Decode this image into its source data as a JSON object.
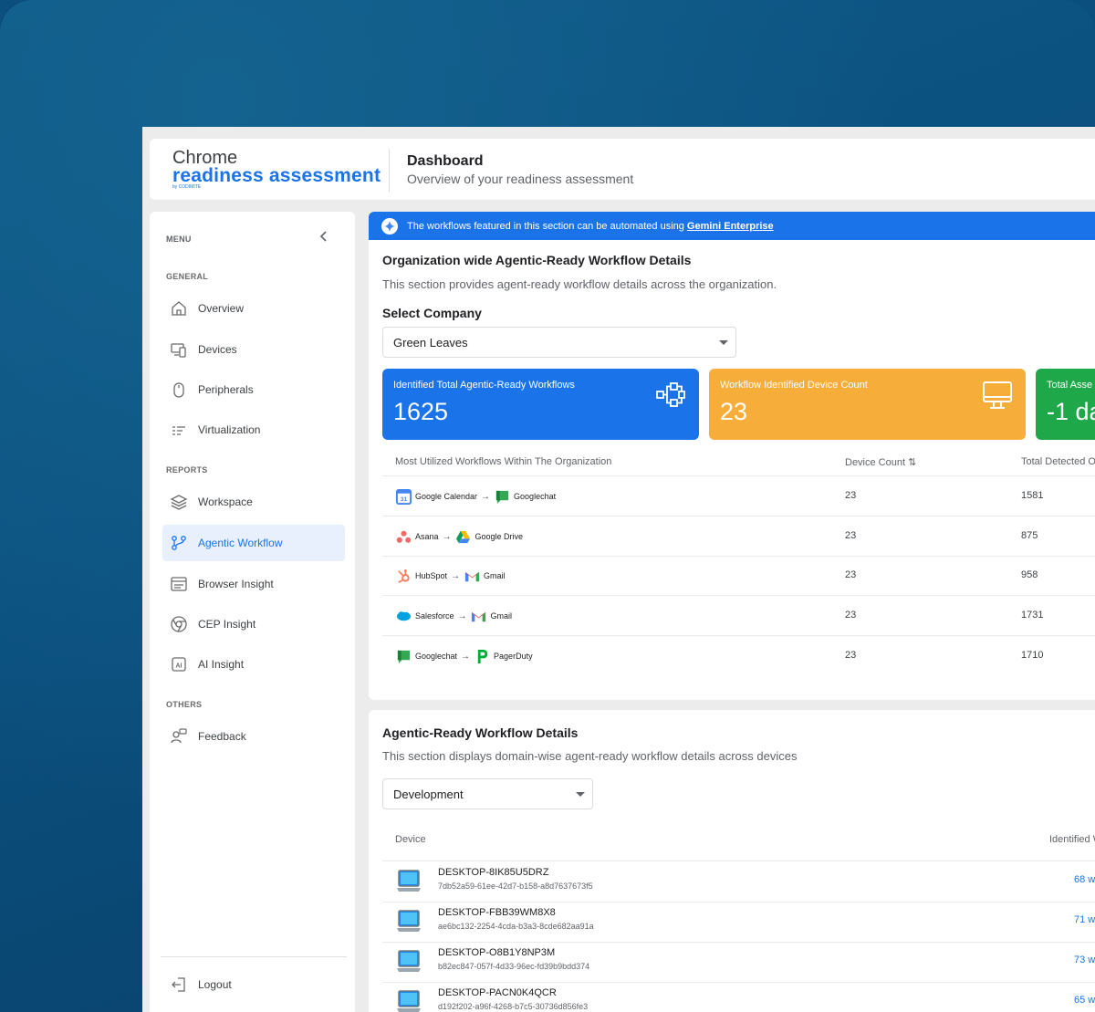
{
  "app": {
    "logo_line1": "Chrome",
    "logo_line2": "readiness assessment",
    "logo_line3": "by CODIMITE",
    "page_title": "Dashboard",
    "page_subtitle": "Overview of your readiness assessment"
  },
  "sidebar": {
    "menu_label": "MENU",
    "collapse_icon": "chevron-left-icon",
    "sections": {
      "general": "GENERAL",
      "reports": "REPORTS",
      "others": "OTHERS"
    },
    "items": [
      {
        "label": "Overview",
        "icon": "home-icon"
      },
      {
        "label": "Devices",
        "icon": "devices-icon"
      },
      {
        "label": "Peripherals",
        "icon": "mouse-icon"
      },
      {
        "label": "Virtualization",
        "icon": "list-icon"
      },
      {
        "label": "Workspace",
        "icon": "layers-icon"
      },
      {
        "label": "Agentic Workflow",
        "icon": "workflow-icon",
        "active": true
      },
      {
        "label": "Browser Insight",
        "icon": "browser-icon"
      },
      {
        "label": "CEP Insight",
        "icon": "chrome-icon"
      },
      {
        "label": "AI Insight",
        "icon": "ai-icon"
      },
      {
        "label": "Feedback",
        "icon": "feedback-icon"
      },
      {
        "label": "Logout",
        "icon": "logout-icon"
      }
    ]
  },
  "banner": {
    "text": "The workflows featured in this section can be automated using",
    "link": "Gemini Enterprise"
  },
  "org_section": {
    "title": "Organization wide Agentic-Ready Workflow Details",
    "subtitle": "This section provides agent-ready workflow details across the organization.",
    "select_label": "Select Company",
    "selected_company": "Green Leaves",
    "stats": [
      {
        "label": "Identified Total Agentic-Ready Workflows",
        "value": "1625",
        "color": "#1a73e8",
        "icon": "workflow-graph-icon"
      },
      {
        "label": "Workflow Identified Device Count",
        "value": "23",
        "color": "#f7ad39",
        "icon": "monitor-icon"
      },
      {
        "label": "Total Asse",
        "value": "-1 da",
        "color": "#1fa84a",
        "icon": ""
      }
    ],
    "table": {
      "headers": [
        "Most Utilized Workflows Within The Organization",
        "Device Count ⇅",
        "Total Detected O"
      ],
      "rows": [
        {
          "from": "Google Calendar",
          "from_icon": "google-calendar-icon",
          "to": "Googlechat",
          "to_icon": "googlechat-icon",
          "device_count": "23",
          "total": "1581"
        },
        {
          "from": "Asana",
          "from_icon": "asana-icon",
          "to": "Google Drive",
          "to_icon": "google-drive-icon",
          "device_count": "23",
          "total": "875"
        },
        {
          "from": "HubSpot",
          "from_icon": "hubspot-icon",
          "to": "Gmail",
          "to_icon": "gmail-icon",
          "device_count": "23",
          "total": "958"
        },
        {
          "from": "Salesforce",
          "from_icon": "salesforce-icon",
          "to": "Gmail",
          "to_icon": "gmail-icon",
          "device_count": "23",
          "total": "1731"
        },
        {
          "from": "Googlechat",
          "from_icon": "googlechat-icon",
          "to": "PagerDuty",
          "to_icon": "pagerduty-icon",
          "device_count": "23",
          "total": "1710"
        }
      ]
    }
  },
  "device_section": {
    "title": "Agentic-Ready Workflow Details",
    "subtitle": "This section displays domain-wise agent-ready workflow details across devices",
    "selected_domain": "Development",
    "headers": [
      "Device",
      "Identified W"
    ],
    "rows": [
      {
        "name": "DESKTOP-8IK85U5DRZ",
        "id": "7db52a59-61ee-42d7-b158-a8d7637673f5",
        "workflows": "68 w"
      },
      {
        "name": "DESKTOP-FBB39WM8X8",
        "id": "ae6bc132-2254-4cda-b3a3-8cde682aa91a",
        "workflows": "71 w"
      },
      {
        "name": "DESKTOP-O8B1Y8NP3M",
        "id": "b82ec847-057f-4d33-96ec-fd39b9bdd374",
        "workflows": "73 w"
      },
      {
        "name": "DESKTOP-PACN0K4QCR",
        "id": "d192f202-a96f-4268-b7c5-30736d856fe3",
        "workflows": "65 w"
      }
    ]
  }
}
